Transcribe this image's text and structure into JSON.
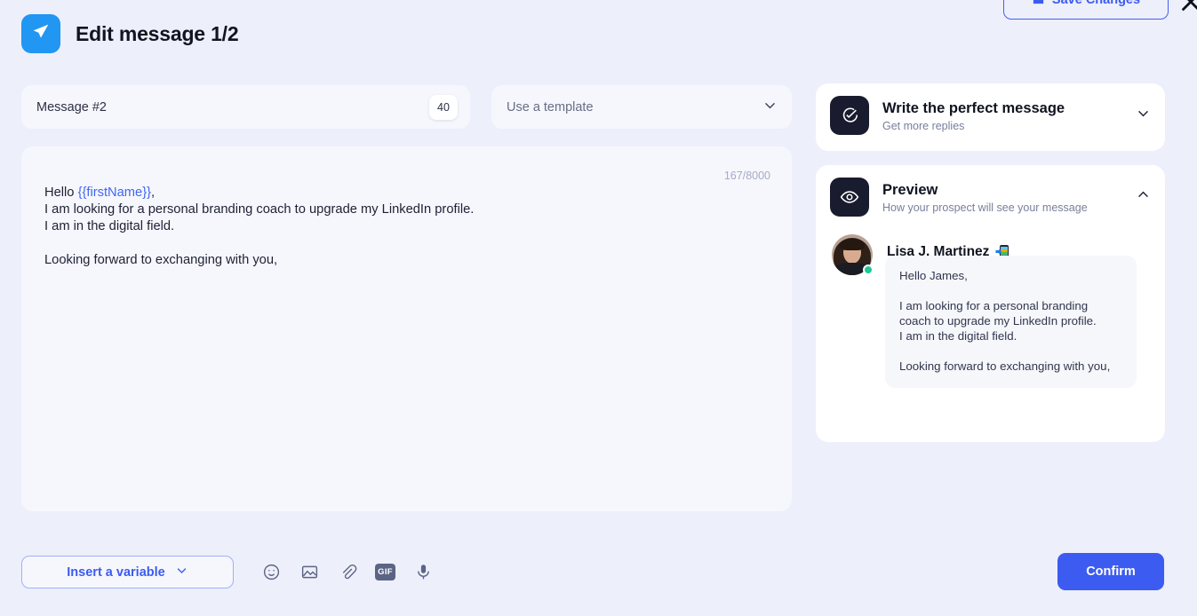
{
  "header": {
    "title": "Edit message 1/2",
    "logo_icon": "send-plane-icon",
    "save_label": "Save Changes",
    "save_icon": "save-disk-icon",
    "close_icon": "close-icon"
  },
  "message_field": {
    "name": "Message #2",
    "badge": "40"
  },
  "template": {
    "placeholder": "Use a template",
    "chevron_icon": "chevron-down-icon"
  },
  "editor": {
    "char_count": "167/8000",
    "greeting_prefix": "Hello ",
    "variable": "{{firstName}}",
    "greeting_suffix": ",",
    "body": "\nI am looking for a personal branding coach to upgrade my LinkedIn profile.\nI am in the digital field.\n\nLooking forward to exchanging with you,"
  },
  "toolbar": {
    "insert_variable_label": "Insert a variable",
    "insert_variable_chevron": "chevron-down-icon",
    "icons": [
      {
        "name": "emoji-icon"
      },
      {
        "name": "image-icon"
      },
      {
        "name": "attachment-icon"
      },
      {
        "name": "gif-icon",
        "label": "GIF"
      },
      {
        "name": "microphone-icon"
      }
    ],
    "confirm_label": "Confirm"
  },
  "sidebar": {
    "tips_card": {
      "icon": "chat-check-icon",
      "title": "Write the perfect message",
      "subtitle": "Get more replies",
      "chevron_icon": "chevron-down-icon"
    },
    "preview_card": {
      "icon": "eye-icon",
      "title": "Preview",
      "subtitle": "How your prospect will see your message",
      "chevron_icon": "chevron-up-icon",
      "person_name": "Lisa J. Martinez",
      "person_badge_icon": "linkedin-device-icon",
      "avatar_icon": "avatar",
      "status": "online",
      "message": "Hello James,\n\nI am looking for a personal branding\ncoach to upgrade my LinkedIn profile.\nI am in the digital field.\n\nLooking forward to exchanging with you,"
    }
  },
  "colors": {
    "accent": "#3C5BF0",
    "logo": "#2196F3",
    "background": "#EDEFFB",
    "panel": "#F6F7FD",
    "status_online": "#1FC99A"
  }
}
